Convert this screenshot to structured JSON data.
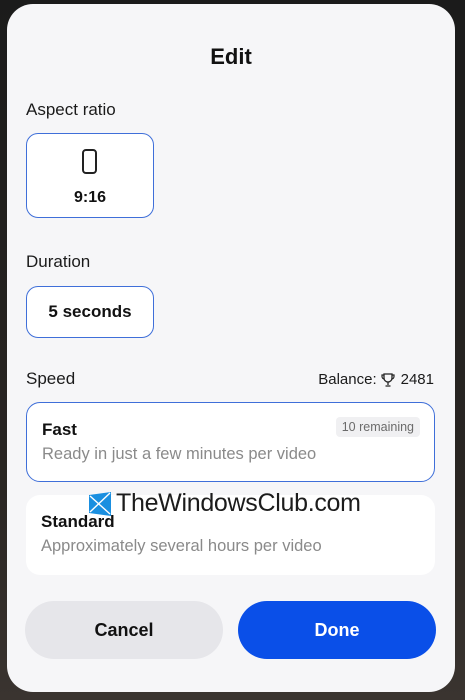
{
  "dialog": {
    "title": "Edit"
  },
  "aspect_ratio": {
    "label": "Aspect ratio",
    "value": "9:16",
    "icon": "phone-portrait-icon"
  },
  "duration": {
    "label": "Duration",
    "value": "5 seconds"
  },
  "speed": {
    "label": "Speed",
    "balance_label": "Balance:",
    "balance_icon": "trophy-icon",
    "balance_value": "2481",
    "options": [
      {
        "title": "Fast",
        "description": "Ready in just a few minutes per video",
        "badge": "10 remaining",
        "selected": true
      },
      {
        "title": "Standard",
        "description": "Approximately several hours per video",
        "selected": false
      }
    ]
  },
  "watermark": {
    "text": "TheWindowsClub.com"
  },
  "actions": {
    "cancel_label": "Cancel",
    "done_label": "Done"
  },
  "colors": {
    "accent": "#0a4fe8",
    "selected_border": "#3f6fd9",
    "dialog_bg": "#f6f6f8",
    "muted_text": "#8a8a8a"
  }
}
